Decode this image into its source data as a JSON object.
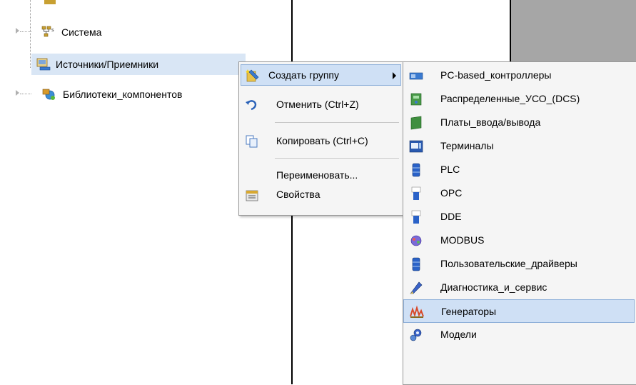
{
  "tree": {
    "items": [
      {
        "label": "Система",
        "icon": "network-icon"
      },
      {
        "label": "Источники/Приемники",
        "icon": "sources-receivers-icon"
      },
      {
        "label": "Библиотеки_компонентов",
        "icon": "component-libraries-icon"
      }
    ]
  },
  "context_menu": {
    "items": [
      {
        "label": "Создать группу",
        "icon": "create-group-icon"
      },
      {
        "label": "Отменить (Ctrl+Z)",
        "icon": "undo-icon"
      },
      {
        "label": "Копировать (Ctrl+C)",
        "icon": "copy-icon"
      },
      {
        "label": "Переименовать...",
        "icon": ""
      },
      {
        "label": "Свойства",
        "icon": "properties-icon"
      }
    ]
  },
  "submenu": {
    "items": [
      {
        "label": "PC-based_контроллеры",
        "icon": "pc-controller-icon"
      },
      {
        "label": "Распределенные_УСО_(DCS)",
        "icon": "dcs-icon"
      },
      {
        "label": "Платы_ввода/вывода",
        "icon": "io-board-icon"
      },
      {
        "label": "Терминалы",
        "icon": "terminal-icon"
      },
      {
        "label": "PLC",
        "icon": "plc-icon"
      },
      {
        "label": "OPC",
        "icon": "opc-icon"
      },
      {
        "label": "DDE",
        "icon": "dde-icon"
      },
      {
        "label": "MODBUS",
        "icon": "modbus-icon"
      },
      {
        "label": "Пользовательские_драйверы",
        "icon": "custom-drivers-icon"
      },
      {
        "label": "Диагностика_и_сервис",
        "icon": "diagnostics-icon"
      },
      {
        "label": "Генераторы",
        "icon": "generators-icon"
      },
      {
        "label": "Модели",
        "icon": "models-icon"
      }
    ],
    "highlighted_index": 10
  },
  "colors": {
    "highlight": "#cfe0f5",
    "highlight_border": "#8fb0d9",
    "panel_gray": "#a6a6a6"
  }
}
